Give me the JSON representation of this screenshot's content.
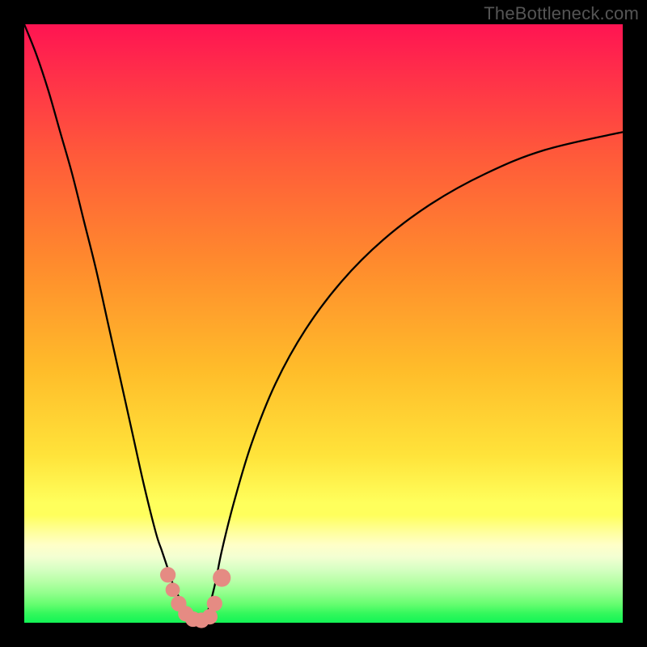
{
  "watermark": "TheBottleneck.com",
  "colors": {
    "frame_bg": "#000000",
    "watermark_text": "#555555",
    "curve_stroke": "#000000",
    "marker_fill": "#e58b83",
    "gradient_stops": [
      "#ff1452",
      "#ff2e4a",
      "#ff5a3a",
      "#ff8b2d",
      "#ffbd2a",
      "#ffe33a",
      "#ffff5c",
      "#ffffa0",
      "#ffffc8",
      "#f3ffd2",
      "#d7ffc3",
      "#b8ffa8",
      "#93ff8d",
      "#63fd6e",
      "#32f85c",
      "#12f455"
    ]
  },
  "chart_data": {
    "type": "line",
    "title": "",
    "xlabel": "",
    "ylabel": "",
    "xlim": [
      0,
      100
    ],
    "ylim": [
      0,
      100
    ],
    "note": "Two monotone curves forming a V shape; y≈0 near the notch. Values are percentages of plot area (0,0 bottom-left).",
    "series": [
      {
        "name": "left-curve",
        "x": [
          0,
          2,
          4,
          6,
          8,
          10,
          12,
          14,
          16,
          18,
          20,
          22,
          23,
          24,
          25,
          26,
          27,
          28
        ],
        "y": [
          100,
          95,
          89,
          82,
          75,
          67,
          59,
          50,
          41,
          32,
          23,
          15,
          12,
          9,
          6,
          4,
          2,
          0
        ]
      },
      {
        "name": "right-curve",
        "x": [
          30,
          31,
          32,
          33,
          35,
          38,
          42,
          47,
          53,
          60,
          68,
          77,
          87,
          100
        ],
        "y": [
          0,
          3,
          7,
          12,
          20,
          30,
          40,
          49,
          57,
          64,
          70,
          75,
          79,
          82
        ]
      }
    ],
    "markers": {
      "name": "notch-markers",
      "description": "Salmon rounded markers near the curve minimum",
      "points": [
        {
          "x": 24.0,
          "y": 8.0,
          "r": 1.3
        },
        {
          "x": 24.8,
          "y": 5.5,
          "r": 1.2
        },
        {
          "x": 25.8,
          "y": 3.2,
          "r": 1.3
        },
        {
          "x": 27.0,
          "y": 1.5,
          "r": 1.3
        },
        {
          "x": 28.2,
          "y": 0.6,
          "r": 1.3
        },
        {
          "x": 29.6,
          "y": 0.4,
          "r": 1.3
        },
        {
          "x": 31.0,
          "y": 1.0,
          "r": 1.3
        },
        {
          "x": 31.8,
          "y": 3.2,
          "r": 1.3
        },
        {
          "x": 33.0,
          "y": 7.5,
          "r": 1.5
        }
      ]
    }
  }
}
